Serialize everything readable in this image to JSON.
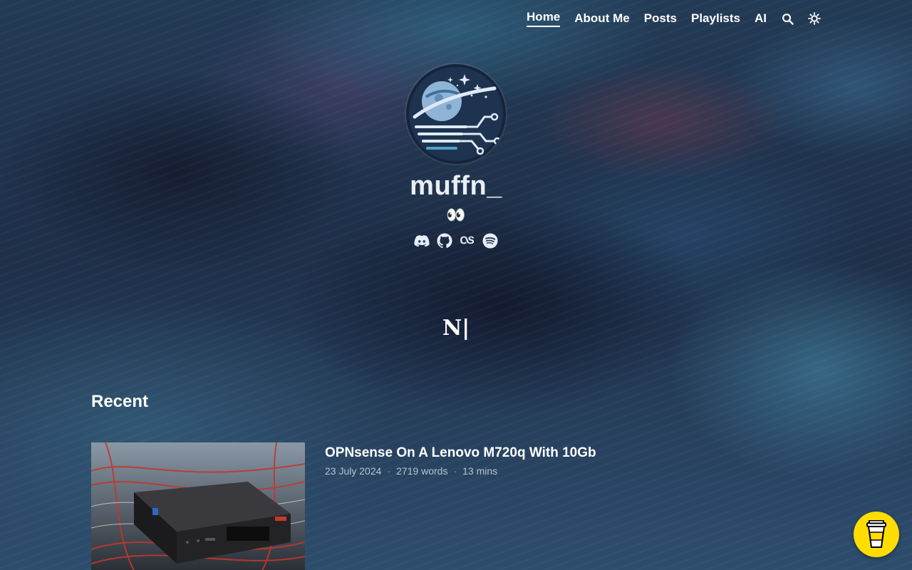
{
  "nav": {
    "items": [
      {
        "label": "Home",
        "active": true
      },
      {
        "label": "About Me",
        "active": false
      },
      {
        "label": "Posts",
        "active": false
      },
      {
        "label": "Playlists",
        "active": false
      },
      {
        "label": "AI",
        "active": false
      }
    ],
    "search_icon": "search-icon",
    "theme_icon": "sun-icon"
  },
  "profile": {
    "name": "muffn_",
    "tagline": "👀",
    "avatar_icon": "planet-circuit-logo",
    "socials": [
      "discord-icon",
      "github-icon",
      "lastfm-icon",
      "spotify-icon"
    ]
  },
  "monogram": "N|",
  "recent": {
    "heading": "Recent",
    "posts": [
      {
        "title": "OPNsense On A Lenovo M720q With 10Gb",
        "date": "23 July 2024",
        "words": "2719 words",
        "read_time": "13 mins"
      }
    ]
  },
  "colors": {
    "accent": "#ffdd00",
    "meta_text": "#b7c3d2"
  },
  "coffee_button_icon": "coffee-cup-icon"
}
